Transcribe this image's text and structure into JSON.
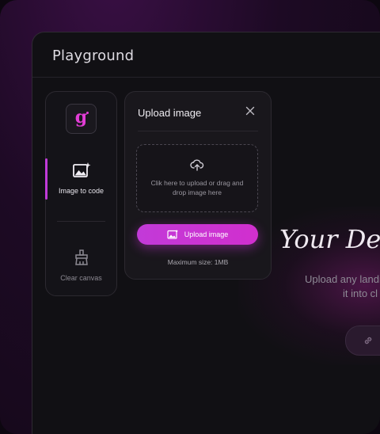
{
  "window": {
    "title": "Playground"
  },
  "tools": {
    "logo_letter": "g",
    "items": [
      {
        "label": "Image to code",
        "icon": "image-sparkle-icon",
        "active": true
      },
      {
        "label": "Clear canvas",
        "icon": "broom-icon",
        "active": false
      }
    ]
  },
  "upload_panel": {
    "title": "Upload image",
    "dropzone_text": "Clik here to upload or drag and drop image here",
    "button_label": "Upload image",
    "max_size": "Maximum size: 1MB"
  },
  "hero": {
    "title": "Your De",
    "subtitle_line1": "Upload any landi",
    "subtitle_line2": "it into cl"
  },
  "colors": {
    "accent": "#c23ad8",
    "logo": "#e23dd5",
    "background": "#111014"
  }
}
